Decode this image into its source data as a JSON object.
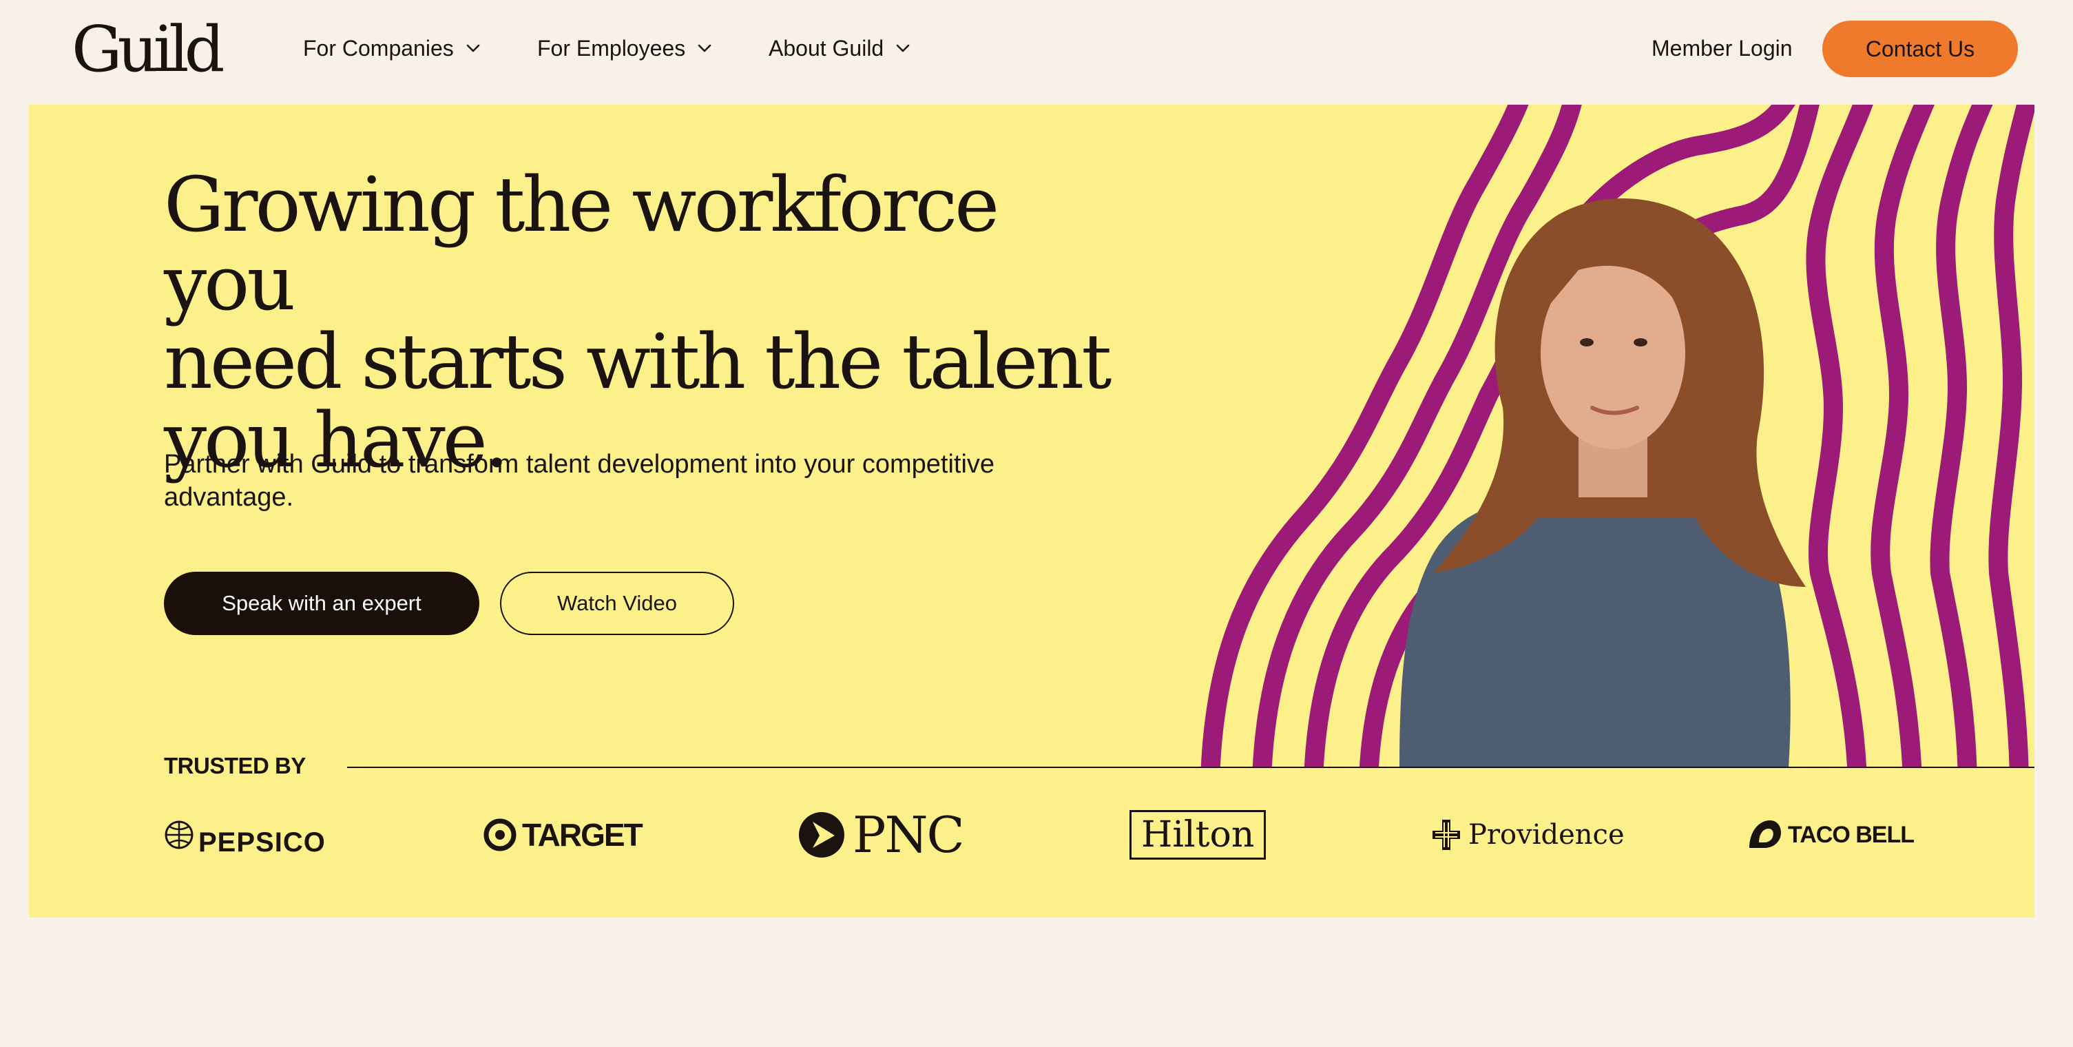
{
  "brand": {
    "logo_text": "Guild"
  },
  "nav": {
    "items": [
      {
        "label": "For Companies"
      },
      {
        "label": "For Employees"
      },
      {
        "label": "About Guild"
      }
    ],
    "member_login": "Member Login",
    "contact_button": "Contact Us"
  },
  "hero": {
    "headline_line1": "Growing the workforce you",
    "headline_line2": "need starts with the talent",
    "headline_line3": "you have.",
    "subtext": "Partner with Guild to transform talent development into your competitive advantage.",
    "primary_button": "Speak with an expert",
    "secondary_button": "Watch Video",
    "background_color": "#fcf08b",
    "stripe_color": "#9c1a78"
  },
  "trusted": {
    "label": "TRUSTED BY",
    "logos": [
      {
        "name": "PEPSICO"
      },
      {
        "name": "TARGET"
      },
      {
        "name": "PNC"
      },
      {
        "name": "Hilton"
      },
      {
        "name": "Providence"
      },
      {
        "name": "TACO BELL"
      }
    ]
  },
  "colors": {
    "page_background": "#f8f1e8",
    "accent_orange": "#ef7a2c",
    "dark": "#1b0f0a"
  }
}
